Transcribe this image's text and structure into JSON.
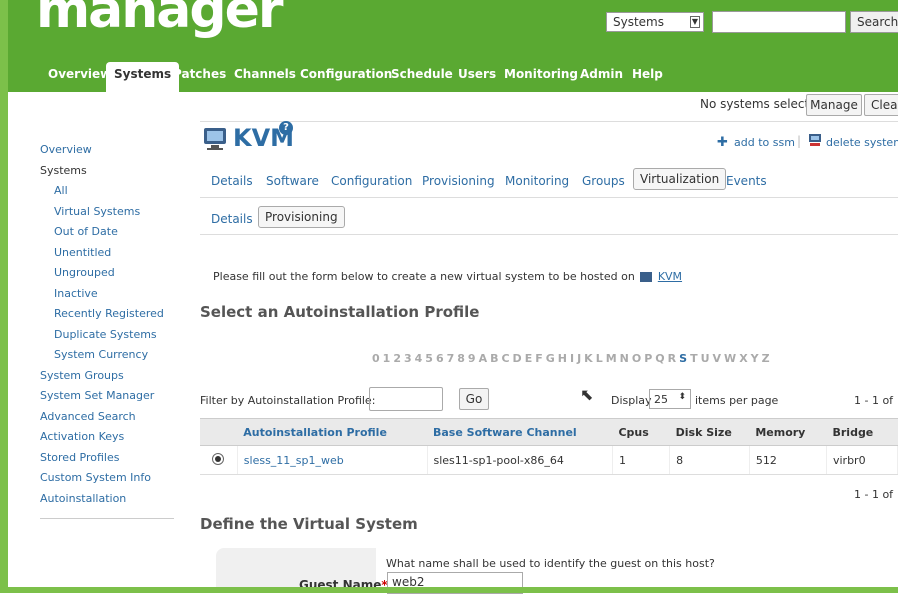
{
  "brand": {
    "logo_text": "manager"
  },
  "search": {
    "scope": "Systems",
    "query": "",
    "button": "Search"
  },
  "topnav": [
    "Overview",
    "Systems",
    "Patches",
    "Channels",
    "Configuration",
    "Schedule",
    "Users",
    "Monitoring",
    "Admin",
    "Help"
  ],
  "ssm": {
    "status": "No systems selected",
    "manage": "Manage",
    "clear": "Clea"
  },
  "sidebar": {
    "items": [
      "Overview",
      "Systems",
      "All",
      "Virtual Systems",
      "Out of Date",
      "Unentitled",
      "Ungrouped",
      "Inactive",
      "Recently Registered",
      "Duplicate Systems",
      "System Currency",
      "System Groups",
      "System Set Manager",
      "Advanced Search",
      "Activation Keys",
      "Stored Profiles",
      "Custom System Info",
      "Autoinstallation"
    ]
  },
  "system": {
    "name": "KVM",
    "help": "?",
    "add_ssm": "add to ssm",
    "delete": "delete system"
  },
  "tabs": [
    "Details",
    "Software",
    "Configuration",
    "Provisioning",
    "Monitoring",
    "Groups",
    "Virtualization",
    "Events"
  ],
  "subtabs": [
    "Details",
    "Provisioning"
  ],
  "intro": "Please fill out the form below to create a new virtual system to be hosted on",
  "intro_link": "KVM",
  "section1": "Select an Autoinstallation Profile",
  "alphabet": [
    "0",
    "1",
    "2",
    "3",
    "4",
    "5",
    "6",
    "7",
    "8",
    "9",
    "A",
    "B",
    "C",
    "D",
    "E",
    "F",
    "G",
    "H",
    "I",
    "J",
    "K",
    "L",
    "M",
    "N",
    "O",
    "P",
    "Q",
    "R",
    "S",
    "T",
    "U",
    "V",
    "W",
    "X",
    "Y",
    "Z"
  ],
  "filter": {
    "label": "Filter by Autoinstallation Profile:",
    "value": "",
    "go": "Go",
    "display": "Display",
    "per_page": "25",
    "per_page_suffix": "items per page",
    "range": "1 - 1 of"
  },
  "table": {
    "columns": [
      "Autoinstallation Profile",
      "Base Software Channel",
      "Cpus",
      "Disk Size",
      "Memory",
      "Bridge"
    ],
    "rows": [
      {
        "profile": "sless_11_sp1_web",
        "channel": "sles11-sp1-pool-x86_64",
        "cpus": "1",
        "disk": "8",
        "memory": "512",
        "bridge": "virbr0"
      }
    ],
    "range_bottom": "1 - 1 of"
  },
  "section2": "Define the Virtual System",
  "guest": {
    "hint": "What name shall be used to identify the guest on this host?",
    "label": "Guest Name",
    "required": "*",
    "colon": ":",
    "value": "web2"
  }
}
